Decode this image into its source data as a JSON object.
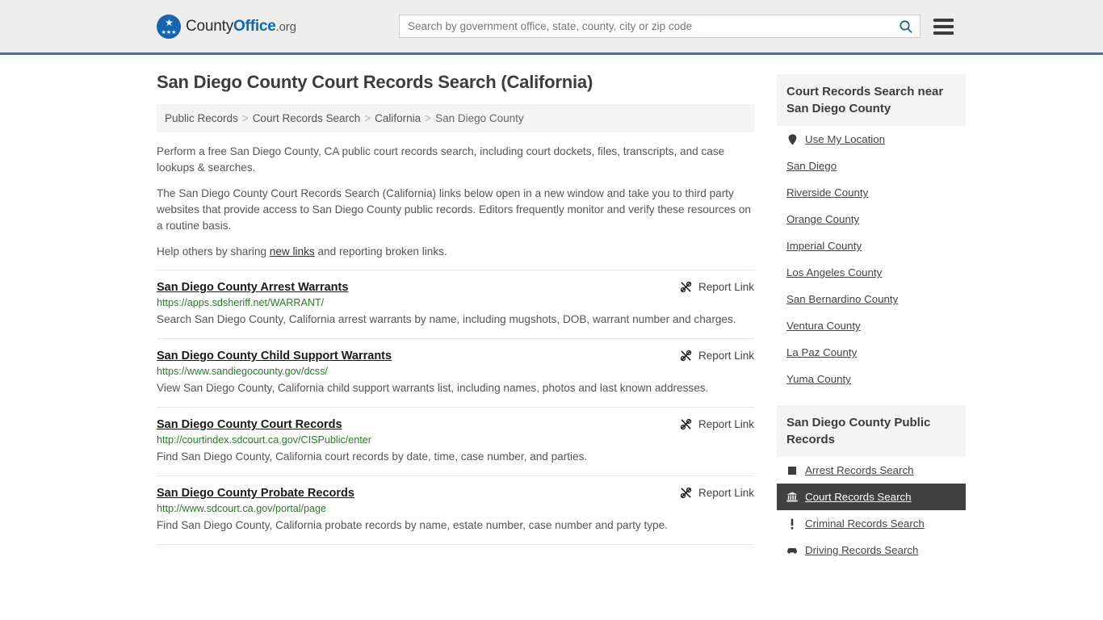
{
  "header": {
    "logo": {
      "county": "County",
      "office": "Office",
      "tld": ".org",
      "mark_icon": "eagle-emblem-icon"
    },
    "search": {
      "placeholder": "Search by government office, state, county, city or zip code",
      "value": "",
      "icon": "search-icon"
    },
    "menu_icon": "hamburger-menu-icon"
  },
  "page": {
    "title": "San Diego County Court Records Search (California)"
  },
  "breadcrumb": {
    "separator": ">",
    "items": [
      {
        "label": "Public Records",
        "current": false
      },
      {
        "label": "Court Records Search",
        "current": false
      },
      {
        "label": "California",
        "current": false
      },
      {
        "label": "San Diego County",
        "current": true
      }
    ]
  },
  "intro": {
    "p1": "Perform a free San Diego County, CA public court records search, including court dockets, files, transcripts, and case lookups & searches.",
    "p2": "The San Diego County Court Records Search (California) links below open in a new window and take you to third party websites that provide access to San Diego County public records. Editors frequently monitor and verify these resources on a routine basis.",
    "p3_before": "Help others by sharing ",
    "p3_link": "new links",
    "p3_after": " and reporting broken links."
  },
  "report_link_label": "Report Link",
  "report_link_icon": "broken-link-icon",
  "results": [
    {
      "title": "San Diego County Arrest Warrants",
      "url": "https://apps.sdsheriff.net/WARRANT/",
      "description": "Search San Diego County, California arrest warrants by name, including mugshots, DOB, warrant number and charges."
    },
    {
      "title": "San Diego County Child Support Warrants",
      "url": "https://www.sandiegocounty.gov/dcss/",
      "description": "View San Diego County, California child support warrants list, including names, photos and last known addresses."
    },
    {
      "title": "San Diego County Court Records",
      "url": "http://courtindex.sdcourt.ca.gov/CISPublic/enter",
      "description": "Find San Diego County, California court records by date, time, case number, and parties."
    },
    {
      "title": "San Diego County Probate Records",
      "url": "http://www.sdcourt.ca.gov/portal/page",
      "description": "Find San Diego County, California probate records by name, estate number, case number and party type."
    }
  ],
  "sidebar": {
    "nearby": {
      "heading": "Court Records Search near San Diego County",
      "items": [
        {
          "label": "Use My Location",
          "icon": "map-pin-icon"
        },
        {
          "label": "San Diego",
          "icon": ""
        },
        {
          "label": "Riverside County",
          "icon": ""
        },
        {
          "label": "Orange County",
          "icon": ""
        },
        {
          "label": "Imperial County",
          "icon": ""
        },
        {
          "label": "Los Angeles County",
          "icon": ""
        },
        {
          "label": "San Bernardino County",
          "icon": ""
        },
        {
          "label": "Ventura County",
          "icon": ""
        },
        {
          "label": "La Paz County",
          "icon": ""
        },
        {
          "label": "Yuma County",
          "icon": ""
        }
      ]
    },
    "public_records": {
      "heading": "San Diego County Public Records",
      "items": [
        {
          "label": "Arrest Records Search",
          "icon": "handcuffs-icon",
          "active": false
        },
        {
          "label": "Court Records Search",
          "icon": "courthouse-icon",
          "active": true
        },
        {
          "label": "Criminal Records Search",
          "icon": "exclamation-icon",
          "active": false
        },
        {
          "label": "Driving Records Search",
          "icon": "car-icon",
          "active": false
        }
      ]
    }
  },
  "colors": {
    "brand_blue": "#1565b0",
    "header_border": "#3a72a8",
    "url_green": "#2a7a2a",
    "active_bg": "#414141"
  }
}
